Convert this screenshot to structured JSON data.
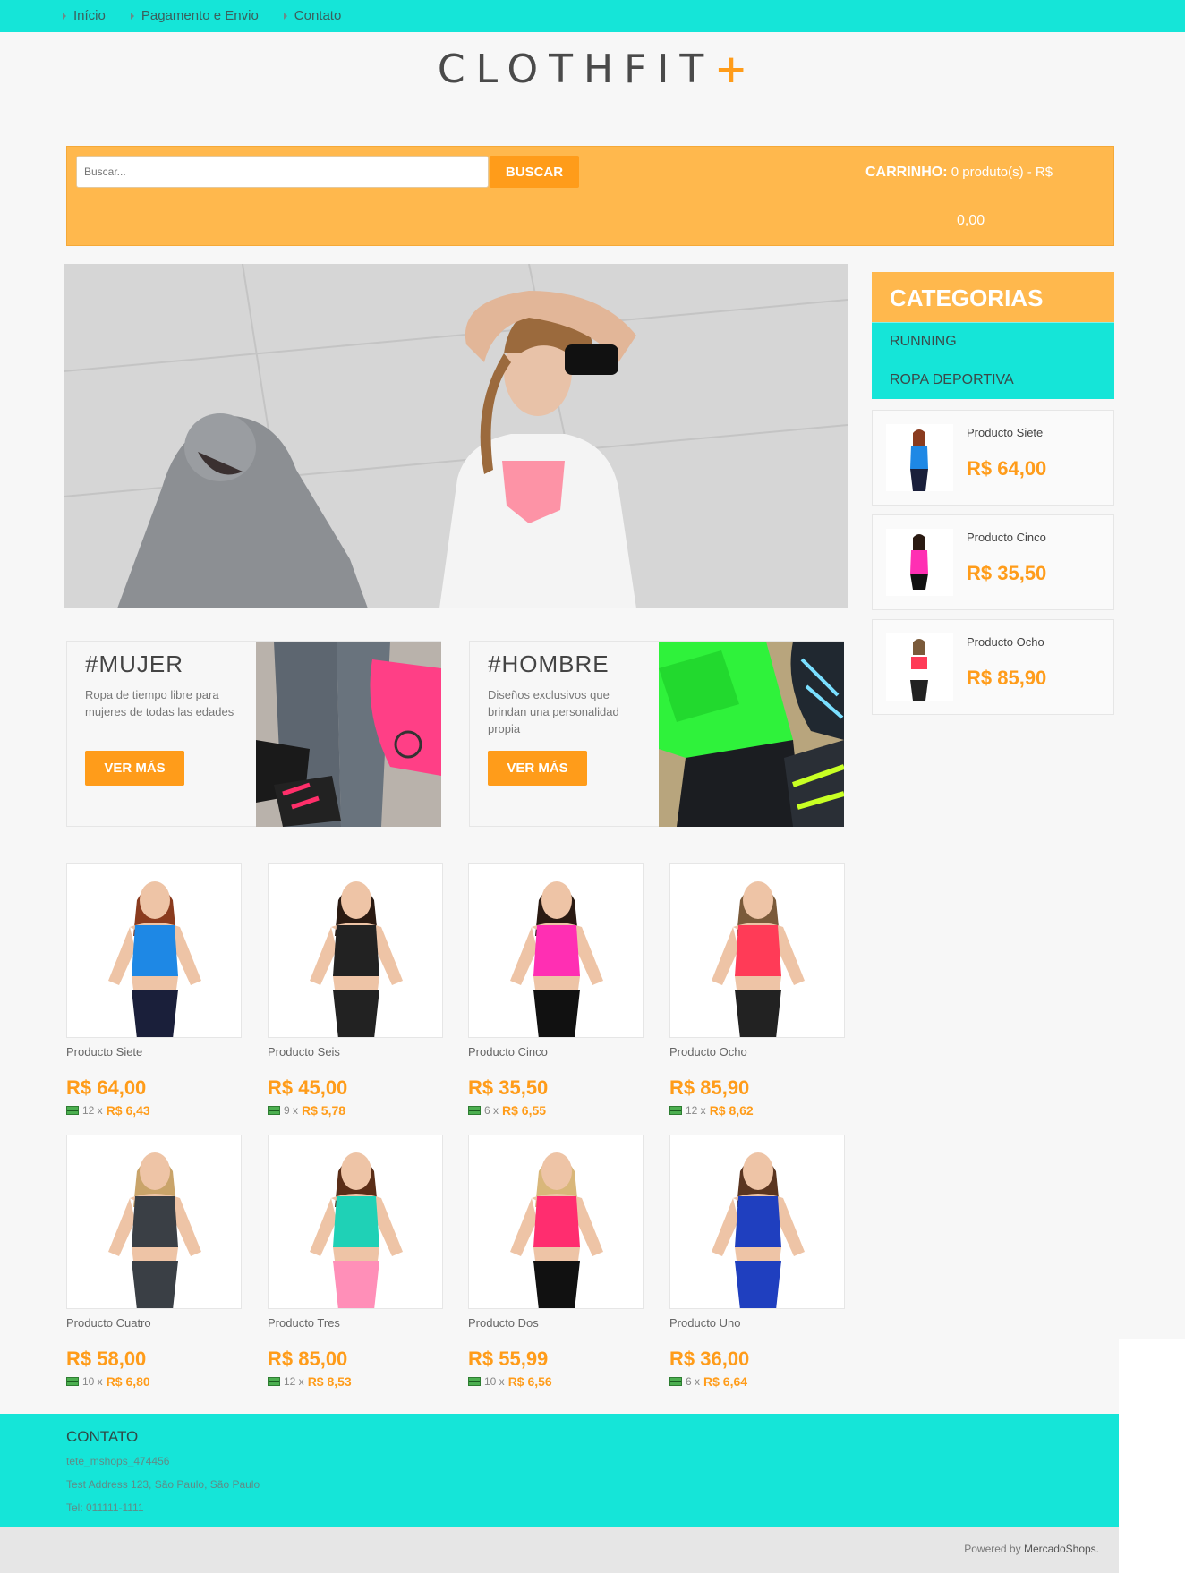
{
  "nav": {
    "items": [
      "Início",
      "Pagamento e Envio",
      "Contato"
    ]
  },
  "logo": {
    "text": "CLOTHFIT",
    "plus": "+"
  },
  "search": {
    "placeholder": "Buscar...",
    "button": "BUSCAR"
  },
  "cart": {
    "label": "CARRINHO:",
    "summary": "0 produto(s) - R$",
    "total": "0,00"
  },
  "promos": [
    {
      "title": "#MUJER",
      "text": "Ropa de tiempo libre para mujeres de todas las edades",
      "button": "VER MÁS"
    },
    {
      "title": "#HOMBRE",
      "text": "Diseños exclusivos que brindan una personalidad propia",
      "button": "VER MÁS"
    }
  ],
  "categories": {
    "title": "CATEGORIAS",
    "items": [
      "RUNNING",
      "ROPA DEPORTIVA"
    ]
  },
  "sidebar_products": [
    {
      "name": "Producto Siete",
      "price": "R$ 64,00"
    },
    {
      "name": "Producto Cinco",
      "price": "R$ 35,50"
    },
    {
      "name": "Producto Ocho",
      "price": "R$ 85,90"
    }
  ],
  "products": [
    {
      "name": "Producto Siete",
      "price": "R$ 64,00",
      "times": "12 x",
      "installment": "R$ 6,43"
    },
    {
      "name": "Producto Seis",
      "price": "R$ 45,00",
      "times": "9 x",
      "installment": "R$ 5,78"
    },
    {
      "name": "Producto Cinco",
      "price": "R$ 35,50",
      "times": "6 x",
      "installment": "R$ 6,55"
    },
    {
      "name": "Producto Ocho",
      "price": "R$ 85,90",
      "times": "12 x",
      "installment": "R$ 8,62"
    },
    {
      "name": "Producto Cuatro",
      "price": "R$ 58,00",
      "times": "10 x",
      "installment": "R$ 6,80"
    },
    {
      "name": "Producto Tres",
      "price": "R$ 85,00",
      "times": "12 x",
      "installment": "R$ 8,53"
    },
    {
      "name": "Producto Dos",
      "price": "R$ 55,99",
      "times": "10 x",
      "installment": "R$ 6,56"
    },
    {
      "name": "Producto Uno",
      "price": "R$ 36,00",
      "times": "6 x",
      "installment": "R$ 6,64"
    }
  ],
  "footer": {
    "title": "CONTATO",
    "store": "tete_mshops_474456",
    "address": "Test Address 123, São Paulo, São Paulo",
    "phone": "Tel: 011111-1111",
    "powered_prefix": "Powered by",
    "powered_brand": "MercadoShops."
  },
  "colors": {
    "accent": "#ff9c1a",
    "teal": "#15e5d8",
    "bar": "#ffb84d"
  },
  "product_tops": [
    "#1e88e5",
    "#222222",
    "#ff2fb3",
    "#ff3b57",
    "#3a3f45",
    "#1fd1b6",
    "#ff2d6f",
    "#1f3fbf"
  ],
  "product_bottoms": [
    "#1a1f3a",
    "#222222",
    "#111111",
    "#222222",
    "#3a3f45",
    "#ff8fb8",
    "#111111",
    "#1f3fbf"
  ],
  "hair": [
    "#8a3b1e",
    "#2a1a12",
    "#2a1a12",
    "#7a5a3a",
    "#c9a46a",
    "#5a2d17",
    "#d9b77a",
    "#5a3520"
  ]
}
